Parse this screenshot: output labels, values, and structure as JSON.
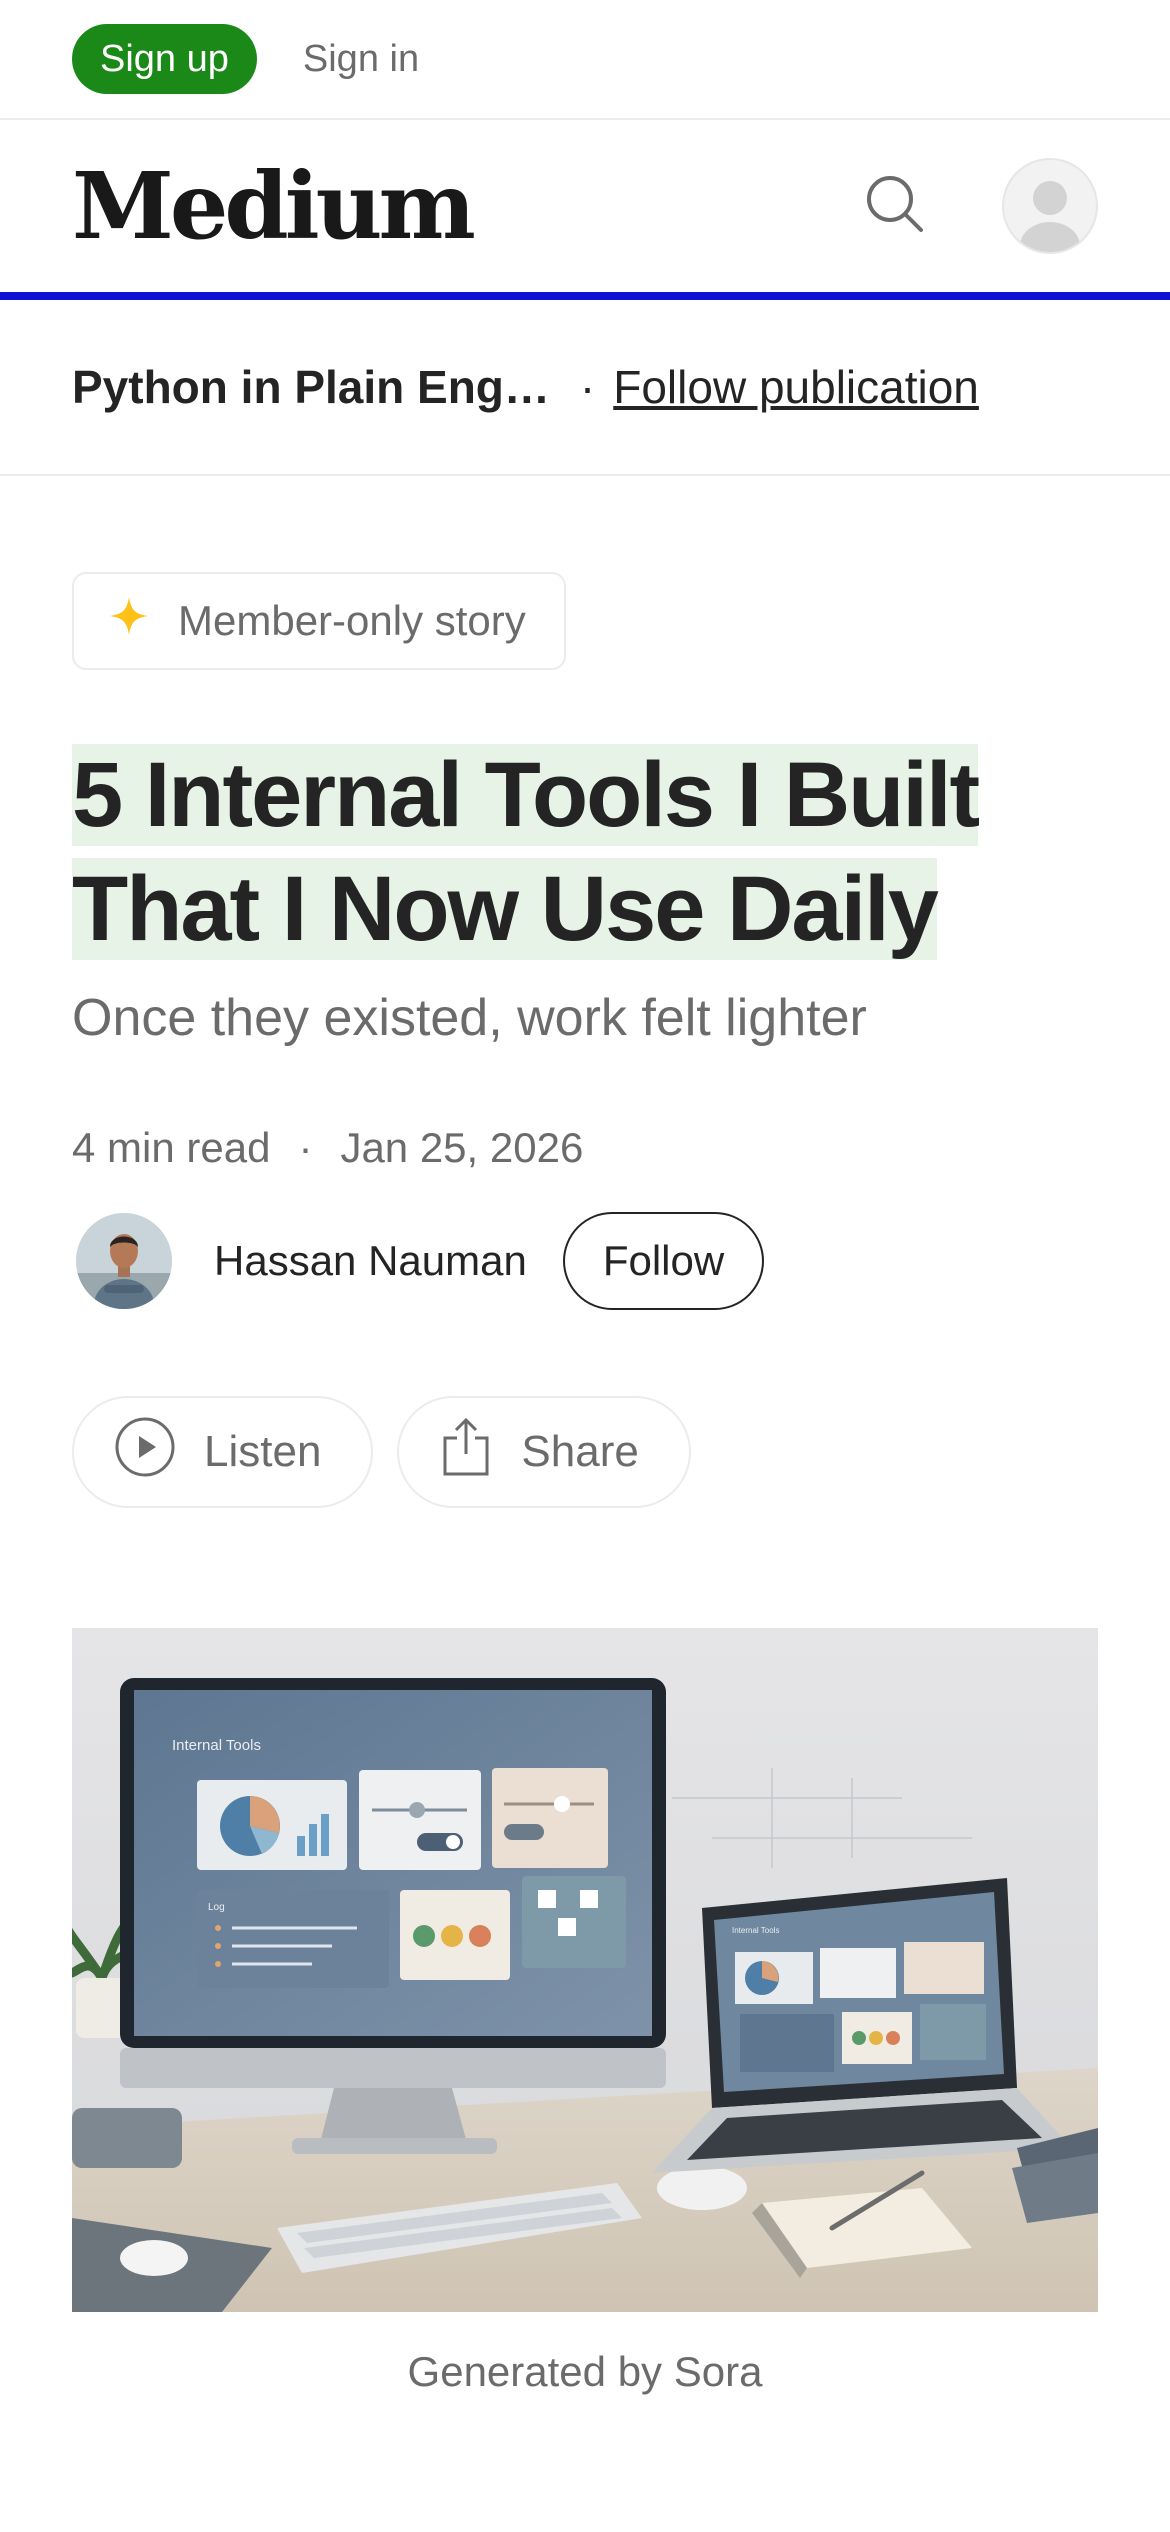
{
  "topbar": {
    "signup_label": "Sign up",
    "signin_label": "Sign in"
  },
  "navbar": {
    "logo": "Medium",
    "search_icon": "search-icon",
    "avatar_icon": "user-avatar-icon"
  },
  "reading_progress": 1.0,
  "publication": {
    "name": "Python in Plain Eng…",
    "separator": "·",
    "follow_label": "Follow publication"
  },
  "badge": {
    "label": "Member-only story",
    "icon": "sparkle-icon",
    "icon_color": "#ffc017"
  },
  "article": {
    "title_line1": "5 Internal Tools I Built",
    "title_line2": "That I Now Use Daily",
    "subtitle": "Once they existed, work felt lighter",
    "read_time": "4 min read",
    "meta_separator": "·",
    "date": "Jan 25, 2026"
  },
  "author": {
    "name": "Hassan Nauman",
    "follow_label": "Follow"
  },
  "actions": {
    "listen_label": "Listen",
    "share_label": "Share"
  },
  "hero": {
    "monitor_label": "Internal Tools",
    "laptop_label": "Internal Tools",
    "log_label": "Log",
    "caption": "Generated by Sora"
  },
  "colors": {
    "brand_green": "#1a8917",
    "progress_blue": "#1212d6",
    "title_highlight": "#e8f3e8"
  }
}
